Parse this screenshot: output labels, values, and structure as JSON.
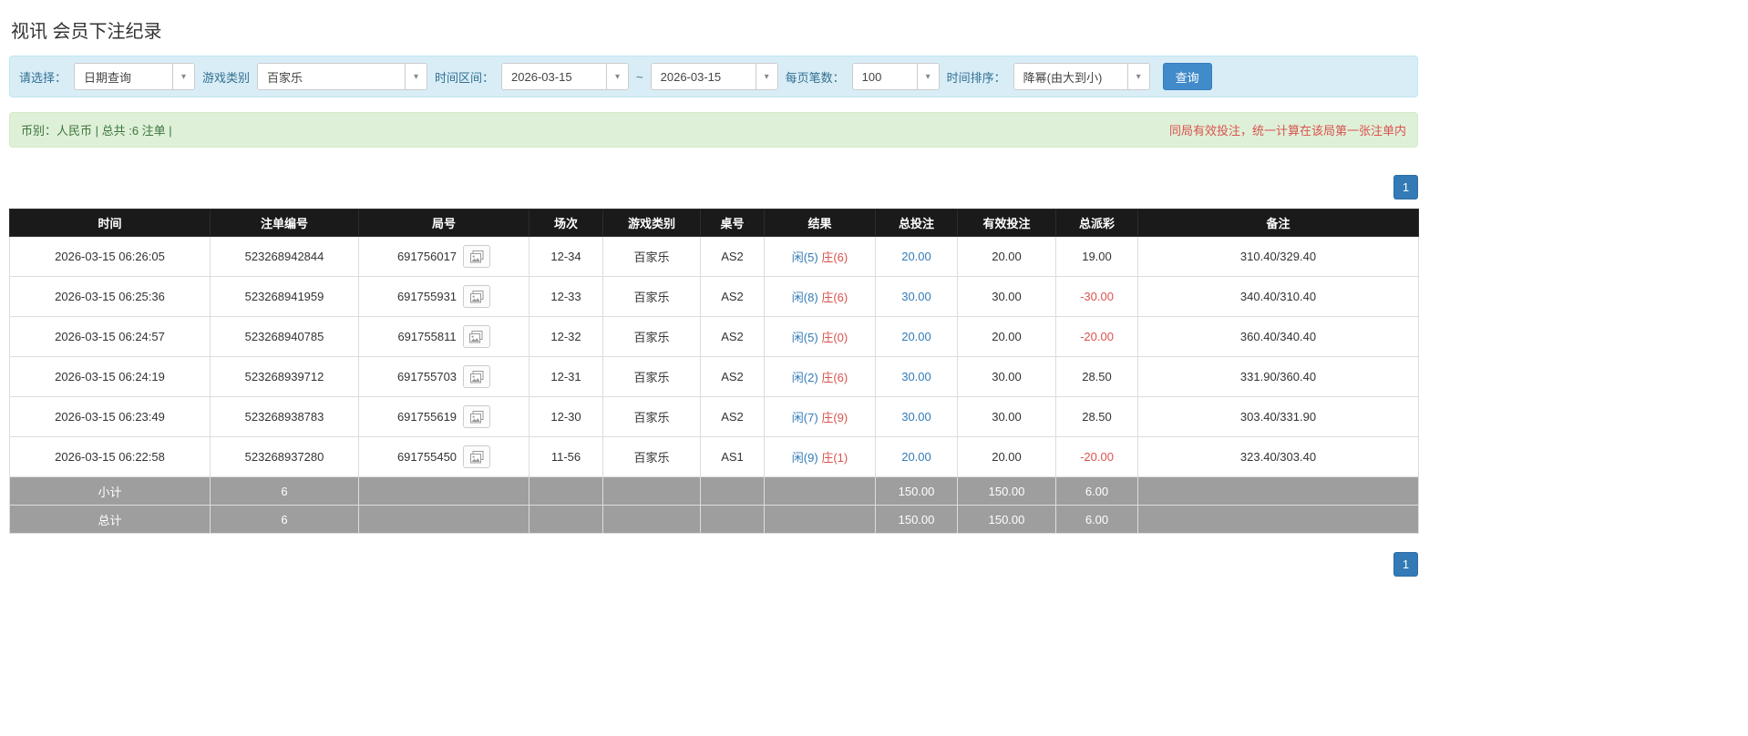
{
  "page": {
    "title": "视讯 会员下注纪录"
  },
  "filters": {
    "select_label": "请选择：",
    "select_value": "日期查询",
    "game_label": "游戏类别",
    "game_value": "百家乐",
    "range_label": "时间区间：",
    "date_from": "2026-03-15",
    "range_separator": "~",
    "date_to": "2026-03-15",
    "page_size_label": "每页笔数：",
    "page_size_value": "100",
    "sort_label": "时间排序：",
    "sort_value": "降幂(由大到小)",
    "search_button": "查询",
    "caret_glyph": "▾"
  },
  "summary": {
    "currency_info": "币别：人民币 | 总共 :6 注单 |",
    "note_right": "同局有效投注，统一计算在该局第一张注单内"
  },
  "pagination": {
    "page": "1"
  },
  "table": {
    "headers": [
      "时间",
      "注单编号",
      "局号",
      "场次",
      "游戏类别",
      "桌号",
      "结果",
      "总投注",
      "有效投注",
      "总派彩",
      "备注"
    ],
    "rows": [
      {
        "time": "2026-03-15 06:26:05",
        "bet_id": "523268942844",
        "round_id": "691756017",
        "session": "12-34",
        "game": "百家乐",
        "table_no": "AS2",
        "result_player": "闲(5)",
        "result_banker": "庄(6)",
        "total_bet": "20.00",
        "valid_bet": "20.00",
        "payout": "19.00",
        "note": "310.40/329.40"
      },
      {
        "time": "2026-03-15 06:25:36",
        "bet_id": "523268941959",
        "round_id": "691755931",
        "session": "12-33",
        "game": "百家乐",
        "table_no": "AS2",
        "result_player": "闲(8)",
        "result_banker": "庄(6)",
        "total_bet": "30.00",
        "valid_bet": "30.00",
        "payout": "-30.00",
        "note": "340.40/310.40"
      },
      {
        "time": "2026-03-15 06:24:57",
        "bet_id": "523268940785",
        "round_id": "691755811",
        "session": "12-32",
        "game": "百家乐",
        "table_no": "AS2",
        "result_player": "闲(5)",
        "result_banker": "庄(0)",
        "total_bet": "20.00",
        "valid_bet": "20.00",
        "payout": "-20.00",
        "note": "360.40/340.40"
      },
      {
        "time": "2026-03-15 06:24:19",
        "bet_id": "523268939712",
        "round_id": "691755703",
        "session": "12-31",
        "game": "百家乐",
        "table_no": "AS2",
        "result_player": "闲(2)",
        "result_banker": "庄(6)",
        "total_bet": "30.00",
        "valid_bet": "30.00",
        "payout": "28.50",
        "note": "331.90/360.40"
      },
      {
        "time": "2026-03-15 06:23:49",
        "bet_id": "523268938783",
        "round_id": "691755619",
        "session": "12-30",
        "game": "百家乐",
        "table_no": "AS2",
        "result_player": "闲(7)",
        "result_banker": "庄(9)",
        "total_bet": "30.00",
        "valid_bet": "30.00",
        "payout": "28.50",
        "note": "303.40/331.90"
      },
      {
        "time": "2026-03-15 06:22:58",
        "bet_id": "523268937280",
        "round_id": "691755450",
        "session": "11-56",
        "game": "百家乐",
        "table_no": "AS1",
        "result_player": "闲(9)",
        "result_banker": "庄(1)",
        "total_bet": "20.00",
        "valid_bet": "20.00",
        "payout": "-20.00",
        "note": "323.40/303.40"
      }
    ],
    "footer_rows": [
      {
        "label": "小计",
        "count": "6",
        "total_bet": "150.00",
        "valid_bet": "150.00",
        "payout": "6.00"
      },
      {
        "label": "总计",
        "count": "6",
        "total_bet": "150.00",
        "valid_bet": "150.00",
        "payout": "6.00"
      }
    ]
  },
  "colors": {
    "link_blue": "#337ab7",
    "player_blue": "#337ab7",
    "banker_red": "#d9534f",
    "negative_red": "#d9534f",
    "header_bg": "#1a1a1a",
    "footer_bg": "#9e9e9e",
    "filter_bg": "#d9edf7",
    "summary_bg": "#dff0d8",
    "accent_button": "#428bca"
  }
}
